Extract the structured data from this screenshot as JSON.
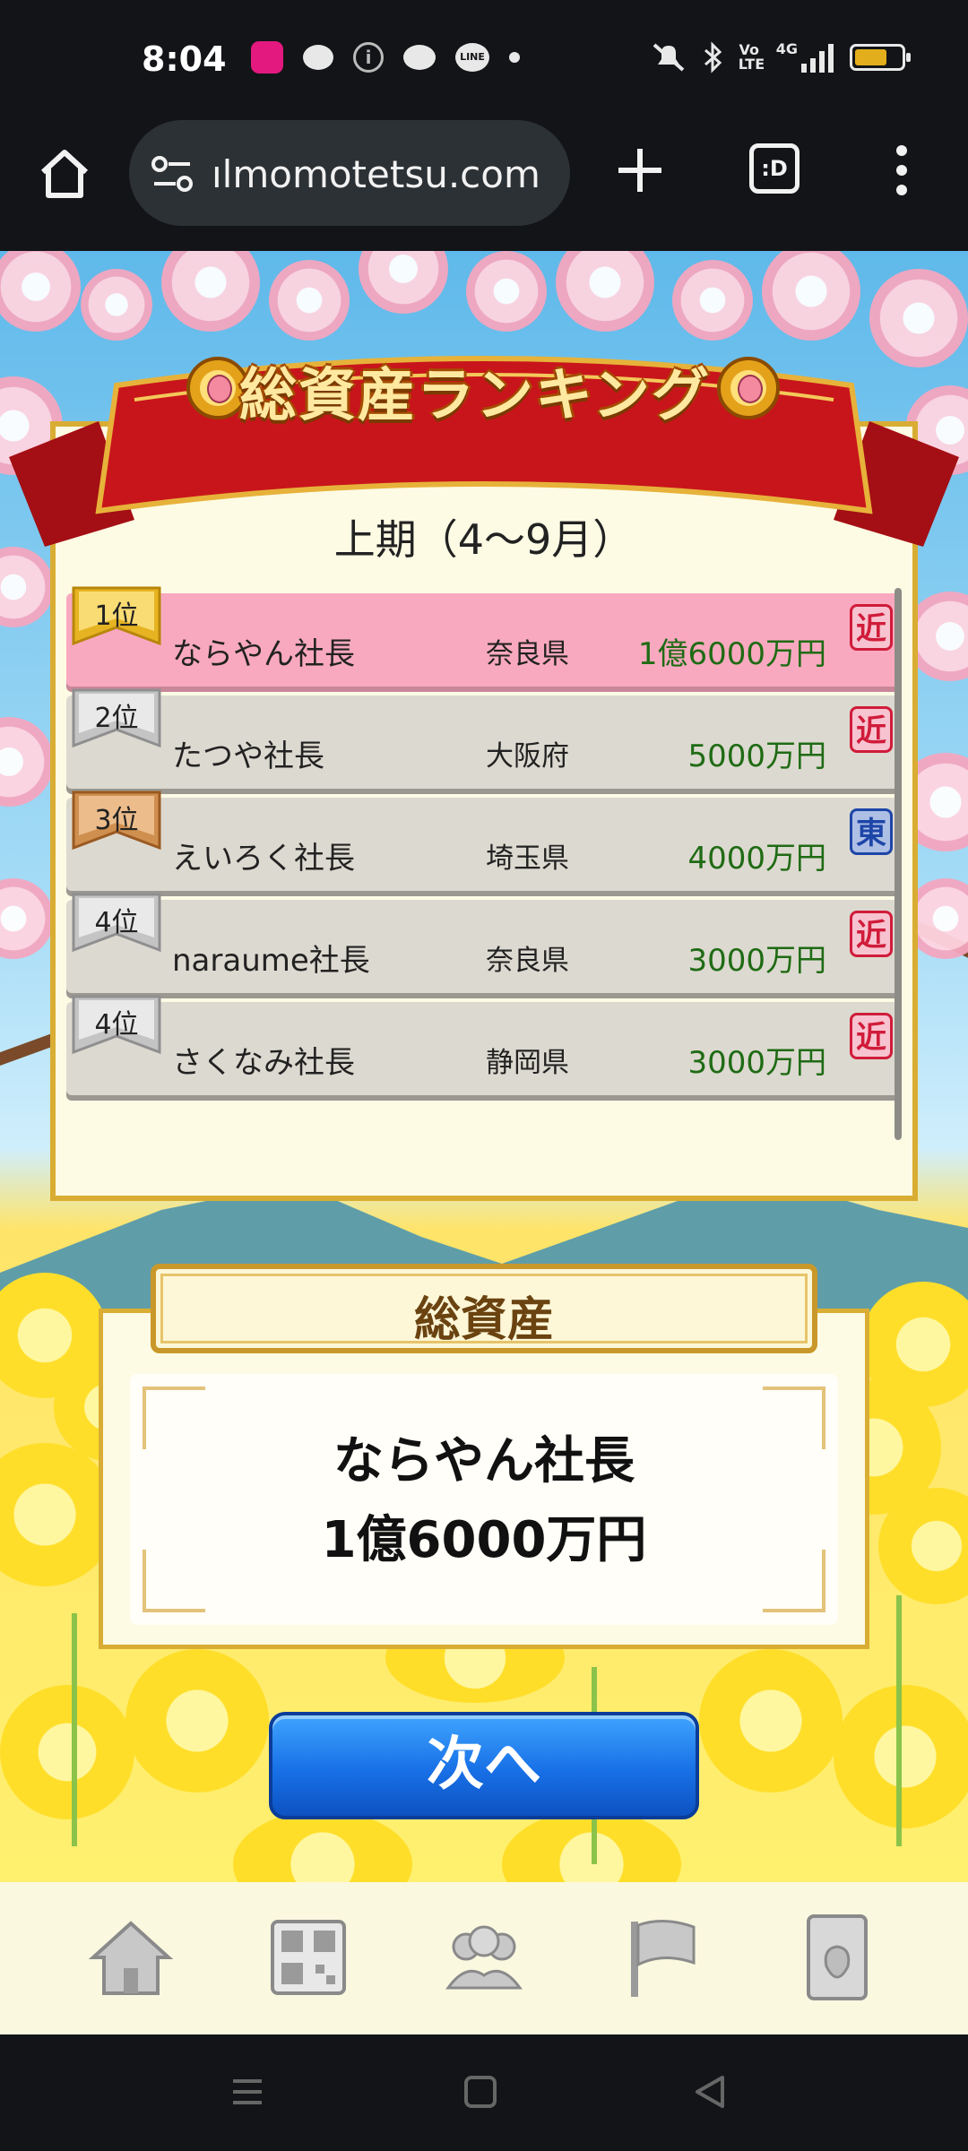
{
  "status_bar": {
    "time": "8:04",
    "network": "4G",
    "volte": "Vo LTE",
    "line_label": "LINE"
  },
  "browser": {
    "url": "ılmomotetsu.com",
    "tab_count": ":D"
  },
  "ranking": {
    "title": "総資産ランキング",
    "period": "上期（4〜9月）",
    "rows": [
      {
        "rank": "1位",
        "name": "ならやん社長",
        "prefecture": "奈良県",
        "amount": "1億6000万円",
        "region": "近",
        "medal": "gold",
        "highlight": true
      },
      {
        "rank": "2位",
        "name": "たつや社長",
        "prefecture": "大阪府",
        "amount": "5000万円",
        "region": "近",
        "medal": "silver",
        "highlight": false
      },
      {
        "rank": "3位",
        "name": "えいろく社長",
        "prefecture": "埼玉県",
        "amount": "4000万円",
        "region": "東",
        "medal": "bronze",
        "highlight": false
      },
      {
        "rank": "4位",
        "name": "naraume社長",
        "prefecture": "奈良県",
        "amount": "3000万円",
        "region": "近",
        "medal": "silver",
        "highlight": false
      },
      {
        "rank": "4位",
        "name": "さくなみ社長",
        "prefecture": "静岡県",
        "amount": "3000万円",
        "region": "近",
        "medal": "silver",
        "highlight": false
      }
    ]
  },
  "total_assets": {
    "title": "総資産",
    "name": "ならやん社長",
    "amount": "1億6000万円"
  },
  "next_button": "次へ",
  "colors": {
    "banner_red": "#c8151b",
    "panel_border": "#d9ad33",
    "highlight_pink": "#f9a9bf",
    "amount_green": "#1f6b14",
    "button_blue": "#1870e6"
  },
  "game_nav": [
    "home-icon",
    "qr-code-icon",
    "friends-icon",
    "flag-icon",
    "card-icon"
  ]
}
